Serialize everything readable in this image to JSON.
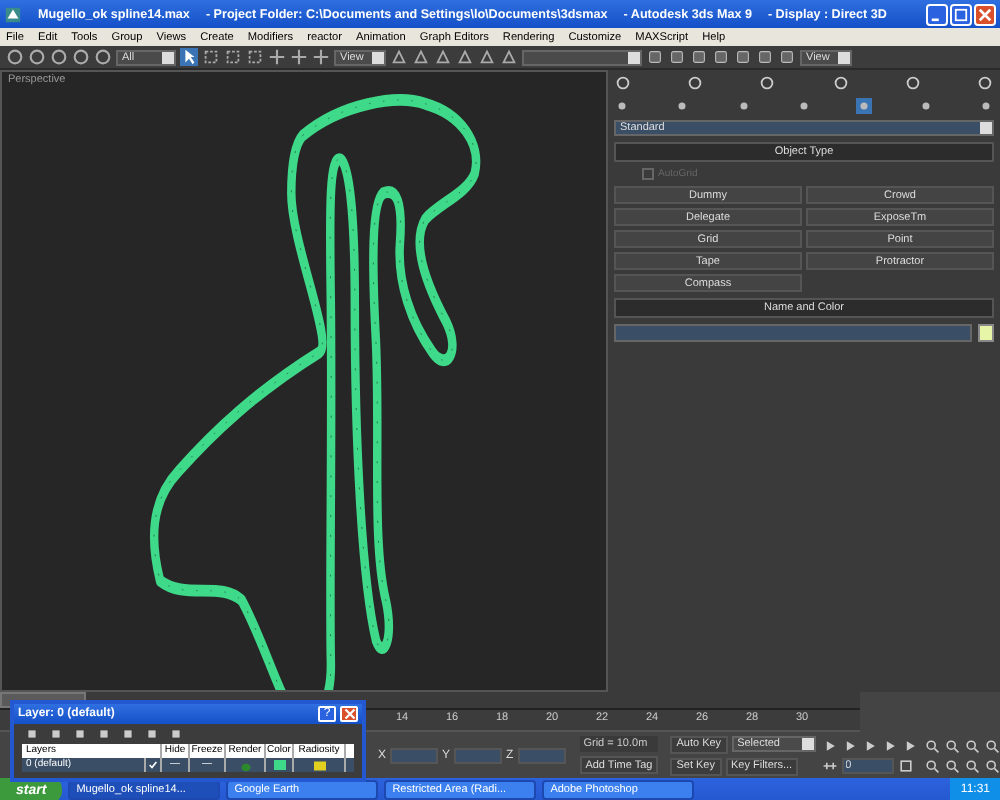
{
  "window": {
    "title_parts": [
      "Mugello_ok spline14.max",
      "- Project Folder: C:\\Documents and Settings\\lo\\Documents\\3dsmax",
      "- Autodesk 3ds Max 9",
      "- Display : Direct 3D"
    ]
  },
  "menu": [
    "File",
    "Edit",
    "Tools",
    "Group",
    "Views",
    "Create",
    "Modifiers",
    "reactor",
    "Animation",
    "Graph Editors",
    "Rendering",
    "Customize",
    "MAXScript",
    "Help"
  ],
  "toolbar": {
    "selection_filter": "All",
    "reference_coord": "View",
    "viewport_dropdown": "View"
  },
  "viewport": {
    "label": "Perspective"
  },
  "command_panel": {
    "category": "Standard",
    "object_type": {
      "title": "Object Type",
      "autogrid": {
        "label": "AutoGrid",
        "checked": false,
        "disabled": true
      },
      "buttons": [
        "Dummy",
        "Crowd",
        "Delegate",
        "ExposeTm",
        "Grid",
        "Point",
        "Tape",
        "Protractor",
        "Compass"
      ]
    },
    "name_and_color": {
      "title": "Name and Color",
      "color": "#e6f5a8"
    }
  },
  "time_slider": {
    "level": 0,
    "ticks": [
      "14",
      "16",
      "18",
      "20",
      "22",
      "24",
      "26",
      "28",
      "30"
    ]
  },
  "status": {
    "coords": [
      "X",
      "Y",
      "Z"
    ],
    "grid": "Grid = 10.0m",
    "add_time_tag": "Add Time Tag",
    "auto_key": "Auto Key",
    "key_mode": "Selected",
    "set_key": "Set Key",
    "key_filters": "Key Filters...",
    "frame": "0"
  },
  "layer_dialog": {
    "title": "Layer: 0 (default)",
    "help": "?",
    "columns": [
      "Layers",
      "Hide",
      "Freeze",
      "Render",
      "Color",
      "Radiosity"
    ],
    "rows": [
      {
        "name": "0 (default)",
        "current": true,
        "hide": "—",
        "freeze": "—",
        "color": "#3fd98a"
      }
    ]
  },
  "taskbar": {
    "start": "start",
    "items": [
      {
        "label": "Mugello_ok spline14...",
        "selected": true
      },
      {
        "label": "Google Earth",
        "selected": false
      },
      {
        "label": "Restricted Area (Radi...",
        "selected": false
      },
      {
        "label": "Adobe Photoshop",
        "selected": false
      }
    ],
    "clock": "11:31"
  }
}
